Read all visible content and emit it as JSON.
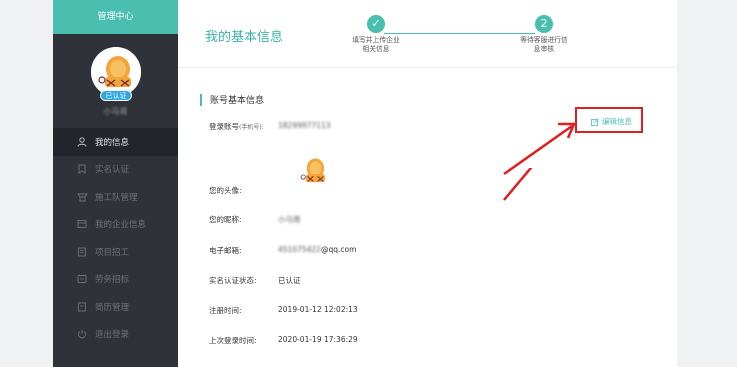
{
  "sidebar": {
    "header": "管理中心",
    "badge": "已认证",
    "username": "小马哥",
    "items": [
      {
        "label": "我的信息",
        "icon": "user-icon",
        "active": true
      },
      {
        "label": "实名认证",
        "icon": "bookmark-icon",
        "active": false
      },
      {
        "label": "施工队管理",
        "icon": "team-icon",
        "active": false
      },
      {
        "label": "我的企业信息",
        "icon": "building-icon",
        "active": false
      },
      {
        "label": "项目招工",
        "icon": "document-icon",
        "active": false
      },
      {
        "label": "劳务招标",
        "icon": "tag-icon",
        "active": false
      },
      {
        "label": "简历管理",
        "icon": "resume-icon",
        "active": false
      },
      {
        "label": "退出登录",
        "icon": "power-icon",
        "active": false
      }
    ]
  },
  "header": {
    "title": "我的基本信息",
    "steps": [
      {
        "marker": "✓",
        "line1": "填写并上传企业",
        "line2": "相关信息"
      },
      {
        "marker": "2",
        "line1": "等待客服进行信",
        "line2": "息审核"
      }
    ]
  },
  "section": {
    "title": "账号基本信息",
    "edit_label": "编辑信息"
  },
  "fields": {
    "account_label": "登录账号",
    "account_note": "(手机号):",
    "account_value": "18299977113",
    "avatar_label": "您的头像:",
    "nickname_label": "您的昵称:",
    "nickname_value": "小马哥",
    "email_label": "电子邮箱:",
    "email_hidden": "451075422",
    "email_suffix": "@qq.com",
    "realname_label": "实名认证状态:",
    "realname_value": "已认证",
    "register_label": "注册时间:",
    "register_value": "2019-01-12 12:02:13",
    "lastlogin_label": "上次登录时间:",
    "lastlogin_value": "2020-01-19 17:36:29"
  },
  "colors": {
    "accent": "#4bbfaf",
    "sidebar_bg": "#2f3339",
    "badge": "#2ea7e0",
    "annotation": "#e01f1f"
  }
}
